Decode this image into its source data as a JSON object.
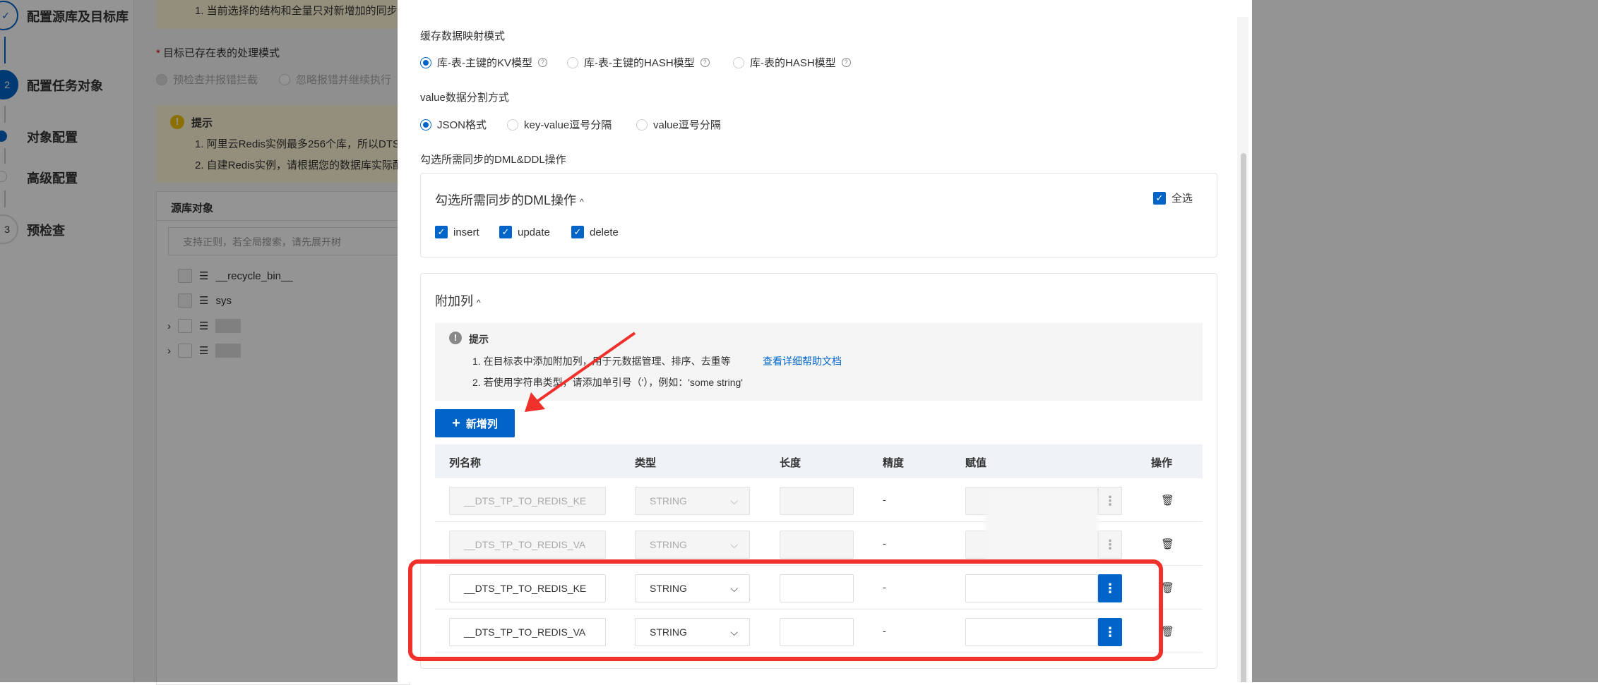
{
  "steps": [
    {
      "num": "✓",
      "label": "配置源库及目标库"
    },
    {
      "num": "2",
      "label": "配置任务对象"
    },
    {
      "label": "对象配置"
    },
    {
      "label": "高级配置"
    },
    {
      "num": "3",
      "label": "预检查"
    }
  ],
  "bg": {
    "notice_line": "1. 当前选择的结构和全量只对新增加的同步",
    "existing_table_label": "目标已存在表的处理模式",
    "existing_table_options": [
      "预检查并报错拦截",
      "忽略报错并继续执行"
    ],
    "tip_title": "提示",
    "tip_lines": [
      "1. 阿里云Redis实例最多256个库，所以DTS",
      "2. 自建Redis实例，请根据您的数据库实际配"
    ],
    "source_title": "源库对象",
    "search_placeholder": "支持正则，若全局搜索，请先展开树",
    "tree": [
      "__recycle_bin__",
      "sys"
    ]
  },
  "drawer": {
    "mapping_label": "缓存数据映射模式",
    "mapping_options": [
      "库-表-主键的KV模型",
      "库-表-主键的HASH模型",
      "库-表的HASH模型"
    ],
    "split_label": "value数据分割方式",
    "split_options": [
      "JSON格式",
      "key-value逗号分隔",
      "value逗号分隔"
    ],
    "dml_section_label": "勾选所需同步的DML&DDL操作",
    "dml_card_title": "勾选所需同步的DML操作",
    "select_all": "全选",
    "dml_ops": [
      "insert",
      "update",
      "delete"
    ],
    "extra_title": "附加列",
    "tip_title": "提示",
    "tip_line1": "1. 在目标表中添加附加列，用于元数据管理、排序、去重等",
    "tip_link": "查看详细帮助文档",
    "tip_line2": "2. 若使用字符串类型，请添加单引号（'），例如：'some string'",
    "add_button": "新增列",
    "columns": [
      "列名称",
      "类型",
      "长度",
      "精度",
      "赋值",
      "操作"
    ],
    "rows": [
      {
        "name": "__DTS_TP_TO_REDIS_KE",
        "type": "STRING",
        "precision": "-",
        "disabled": true
      },
      {
        "name": "__DTS_TP_TO_REDIS_VA",
        "type": "STRING",
        "precision": "-",
        "disabled": true
      },
      {
        "name": "__DTS_TP_TO_REDIS_KE",
        "type": "STRING",
        "precision": "-",
        "disabled": false
      },
      {
        "name": "__DTS_TP_TO_REDIS_VA",
        "type": "STRING",
        "precision": "-",
        "disabled": false
      }
    ]
  },
  "colors": {
    "primary": "#0064c8",
    "annotation": "#f0302a"
  }
}
